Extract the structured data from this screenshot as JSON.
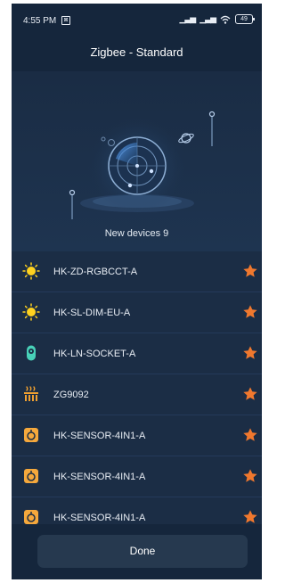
{
  "status_bar": {
    "time": "4:55 PM",
    "notification_glyph": "⊠",
    "signal1": "▁▃▅",
    "signal2": "▁▃▅",
    "wifi_glyph": "wifi-icon",
    "battery_level": "49"
  },
  "header": {
    "title": "Zigbee - Standard"
  },
  "scan": {
    "new_devices_label": "New devices 9"
  },
  "devices": [
    {
      "name": "HK-ZD-RGBCCT-A",
      "icon": "bulb-icon"
    },
    {
      "name": "HK-SL-DIM-EU-A",
      "icon": "bulb-icon"
    },
    {
      "name": "HK-LN-SOCKET-A",
      "icon": "socket-icon"
    },
    {
      "name": "ZG9092",
      "icon": "heater-icon"
    },
    {
      "name": "HK-SENSOR-4IN1-A",
      "icon": "sensor-icon"
    },
    {
      "name": "HK-SENSOR-4IN1-A",
      "icon": "sensor-icon"
    },
    {
      "name": "HK-SENSOR-4IN1-A",
      "icon": "sensor-icon"
    }
  ],
  "footer": {
    "done_label": "Done"
  },
  "colors": {
    "background": "#1b2d45",
    "accent_star": "#f0782e",
    "bulb": "#ffd21f",
    "socket": "#48d1b8",
    "sensor": "#f5a83c",
    "heater": "#f0a030"
  }
}
